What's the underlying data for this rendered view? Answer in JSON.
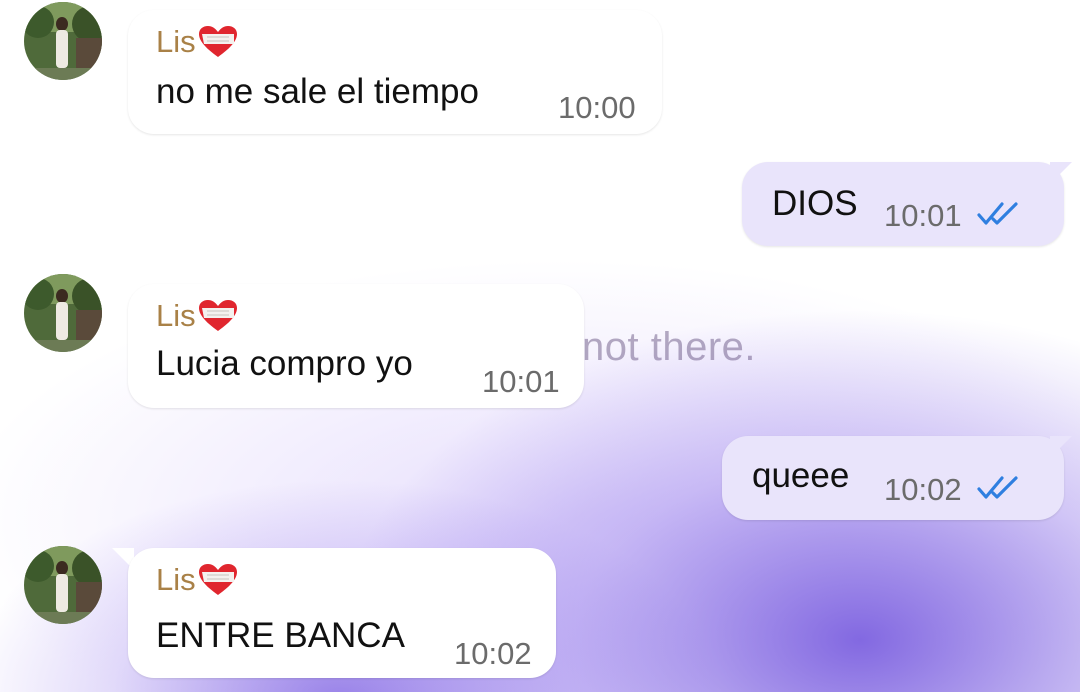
{
  "chat": {
    "wallpaper_text": "not there.",
    "messages": [
      {
        "direction": "in",
        "sender": "Lis",
        "text": "no me sale el tiempo",
        "time": "10:00"
      },
      {
        "direction": "out",
        "text": "DIOS",
        "time": "10:01",
        "status": "read"
      },
      {
        "direction": "in",
        "sender": "Lis",
        "text": "Lucia compro yo",
        "time": "10:01"
      },
      {
        "direction": "out",
        "text": "queee",
        "time": "10:02",
        "status": "read"
      },
      {
        "direction": "in",
        "sender": "Lis",
        "text": "ENTRE BANCA",
        "time": "10:02"
      }
    ]
  },
  "icons": {
    "sender_badge": "heart-bandage-icon",
    "read_status": "double-check-icon",
    "avatar": "contact-photo"
  },
  "colors": {
    "incoming_bubble": "#ffffff",
    "outgoing_bubble": "#e9e4fb",
    "sender_name": "#a98147",
    "read_ticks": "#2f7fe0",
    "wallpaper_accent": "#7a5ce0"
  }
}
